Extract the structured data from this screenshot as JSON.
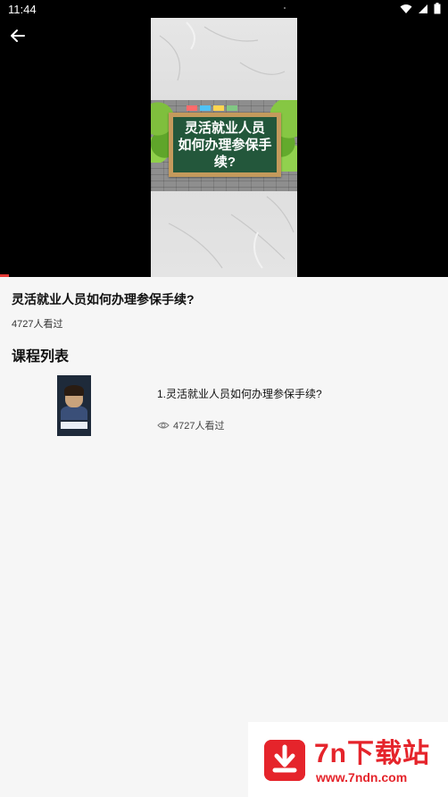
{
  "status_bar": {
    "time": "11:44"
  },
  "video": {
    "board_line1": "灵活就业人员",
    "board_line2": "如何办理参保手续?"
  },
  "course": {
    "title": "灵活就业人员如何办理参保手续?",
    "views": "4727人看过"
  },
  "section_title": "课程列表",
  "lessons": [
    {
      "title": "1.灵活就业人员如何办理参保手续?",
      "views": "4727人看过"
    }
  ],
  "watermark": {
    "name": "7n下载站",
    "url": "www.7ndn.com"
  },
  "colors": {
    "accent": "#e5242b",
    "progress": "#e53935",
    "board": "#23573b"
  }
}
